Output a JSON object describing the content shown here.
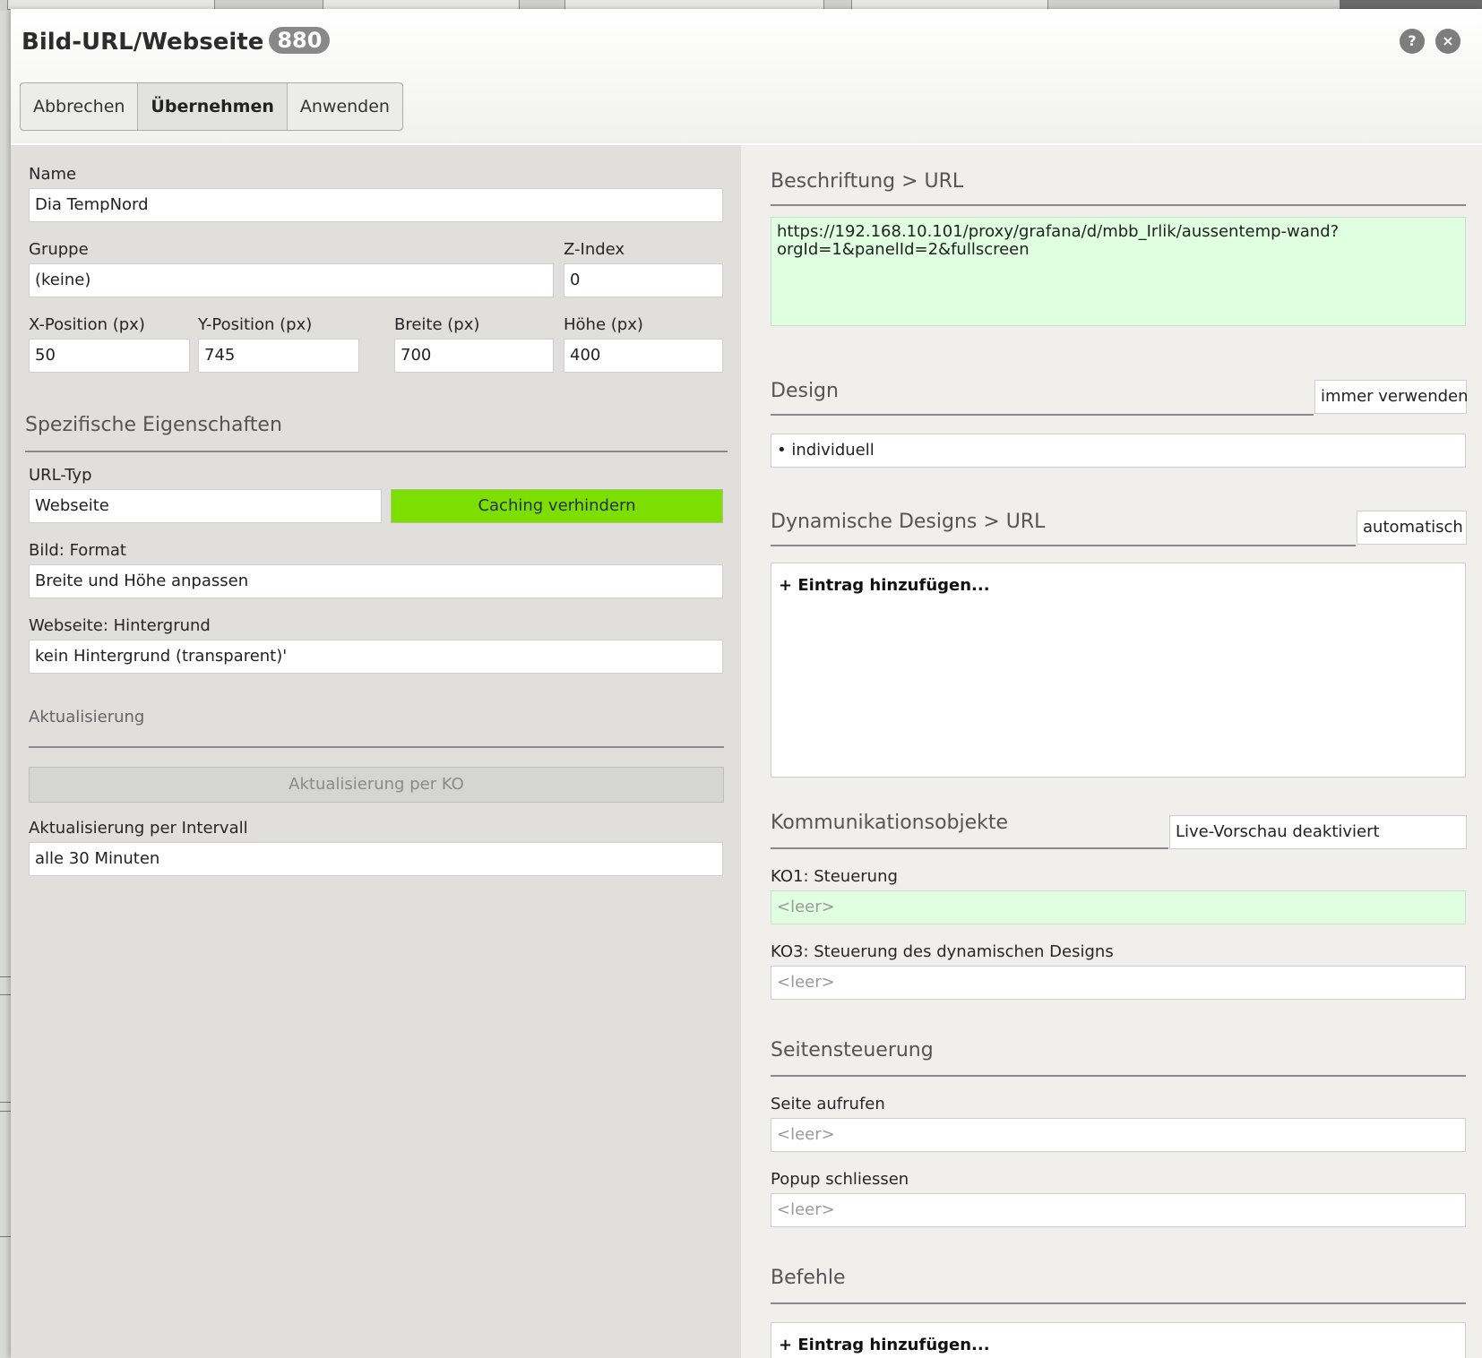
{
  "dialog": {
    "title": "Bild-URL/Webseite",
    "badge": "880",
    "help_icon": "?",
    "close_icon": "×"
  },
  "toolbar": {
    "cancel_label": "Abbrechen",
    "accept_label": "Übernehmen",
    "apply_label": "Anwenden"
  },
  "general": {
    "name_label": "Name",
    "name_value": "Dia TempNord",
    "group_label": "Gruppe",
    "group_value": "(keine)",
    "zindex_label": "Z-Index",
    "zindex_value": "0",
    "xpos_label": "X-Position (px)",
    "xpos_value": "50",
    "ypos_label": "Y-Position (px)",
    "ypos_value": "745",
    "width_label": "Breite (px)",
    "width_value": "700",
    "height_label": "Höhe (px)",
    "height_value": "400"
  },
  "specific": {
    "section_title": "Spezifische Eigenschaften",
    "urltype_label": "URL-Typ",
    "urltype_value": "Webseite",
    "caching_button": "Caching verhindern",
    "format_label": "Bild: Format",
    "format_value": "Breite und Höhe anpassen",
    "background_label": "Webseite: Hintergrund",
    "background_value": "kein Hintergrund (transparent)'"
  },
  "update": {
    "section_title": "Aktualisierung",
    "ko_button": "Aktualisierung per KO",
    "interval_label": "Aktualisierung per Intervall",
    "interval_value": "alle 30 Minuten"
  },
  "caption": {
    "section_title": "Beschriftung > URL",
    "url_value": "https://192.168.10.101/proxy/grafana/d/mbb_Irlik/aussentemp-wand?\norgId=1&panelId=2&fullscreen"
  },
  "design": {
    "section_title": "Design",
    "toggle_label": "immer verwenden",
    "value": "• individuell"
  },
  "dynamic_designs": {
    "section_title": "Dynamische Designs > URL",
    "toggle_label": "automatisch",
    "add_entry": "+ Eintrag hinzufügen..."
  },
  "communication": {
    "section_title": "Kommunikationsobjekte",
    "preview_label": "Live-Vorschau deaktiviert",
    "ko1_label": "KO1: Steuerung",
    "ko1_value": "<leer>",
    "ko3_label": "KO3: Steuerung des dynamischen Designs",
    "ko3_value": "<leer>"
  },
  "page_control": {
    "section_title": "Seitensteuerung",
    "open_page_label": "Seite aufrufen",
    "open_page_value": "<leer>",
    "close_popup_label": "Popup schliessen",
    "close_popup_value": "<leer>"
  },
  "commands": {
    "section_title": "Befehle",
    "add_entry": "+ Eintrag hinzufügen..."
  },
  "colors": {
    "caching_green": "#7ddf00",
    "ko_field_green": "#e0ffe0",
    "badge_gray": "#888888"
  }
}
